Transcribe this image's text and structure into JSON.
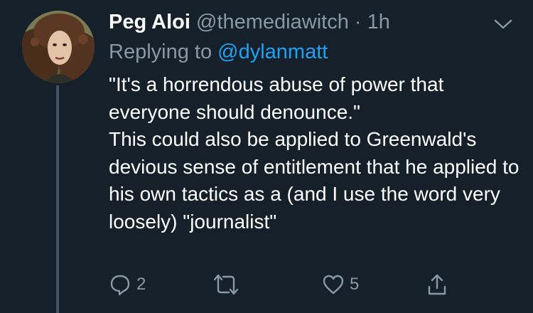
{
  "tweet": {
    "author": {
      "display_name": "Peg Aloi",
      "handle": "@themediawitch",
      "separator": "·",
      "time": "1h",
      "avatar_icon": "profile-photo-avatar"
    },
    "replying": {
      "prefix": "Replying to",
      "mention": "@dylanmatt"
    },
    "text_lines": [
      "\"It's a horrendous abuse of power that everyone should denounce.\"",
      "This could also be applied to Greenwald's devious sense of entitlement that he applied to his own tactics as a (and I use the word very loosely) \"journalist\""
    ],
    "actions": {
      "reply": {
        "icon": "reply-icon",
        "count": "2"
      },
      "retweet": {
        "icon": "retweet-icon",
        "count": ""
      },
      "like": {
        "icon": "heart-icon",
        "count": "5"
      },
      "share": {
        "icon": "share-icon"
      }
    },
    "menu_icon": "chevron-down-icon",
    "colors": {
      "background": "#15202b",
      "text": "#ffffff",
      "secondary": "#8899a6",
      "link": "#1da1f2",
      "thread_line": "#3d5466"
    }
  }
}
